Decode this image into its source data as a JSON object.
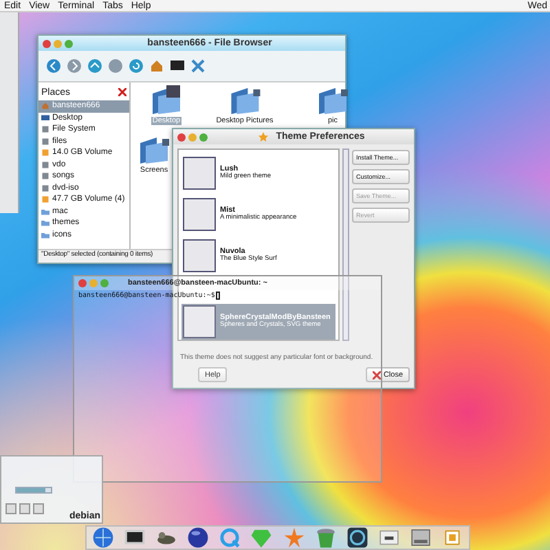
{
  "menu_bar": {
    "items": [
      "Edit",
      "View",
      "Terminal",
      "Tabs",
      "Help"
    ],
    "clock": "Wed"
  },
  "file_browser": {
    "title": "bansteen666 - File Browser",
    "places_label": "Places",
    "places": [
      {
        "label": "bansteen666",
        "kind": "home",
        "selected": true
      },
      {
        "label": "Desktop",
        "kind": "desktop",
        "selected": false
      },
      {
        "label": "File System",
        "kind": "drive",
        "selected": false
      },
      {
        "label": "files",
        "kind": "drive",
        "selected": false
      },
      {
        "label": "14.0 GB Volume",
        "kind": "volume",
        "selected": false
      },
      {
        "label": "vdo",
        "kind": "drive",
        "selected": false
      },
      {
        "label": "songs",
        "kind": "drive",
        "selected": false
      },
      {
        "label": "dvd-iso",
        "kind": "drive",
        "selected": false
      },
      {
        "label": "47.7 GB Volume (4)",
        "kind": "volume",
        "selected": false
      },
      {
        "label": "mac",
        "kind": "bookmark",
        "selected": false
      },
      {
        "label": "themes",
        "kind": "bookmark",
        "selected": false
      },
      {
        "label": "icons",
        "kind": "bookmark",
        "selected": false
      }
    ],
    "files": [
      {
        "label": "Desktop",
        "selected": true
      },
      {
        "label": "Desktop Pictures",
        "selected": false
      },
      {
        "label": "pic",
        "selected": false
      },
      {
        "label": "Screens",
        "selected": false
      }
    ],
    "status": "\"Desktop\" selected (containing 0 items)"
  },
  "theme_window": {
    "title": "Theme Preferences",
    "themes": [
      {
        "name": "Lush",
        "description": "Mild green theme",
        "selected": false
      },
      {
        "name": "Mist",
        "description": "A minimalistic appearance",
        "selected": false
      },
      {
        "name": "Nuvola",
        "description": "The Blue Style Surf",
        "selected": false
      },
      {
        "name": "SphereCrystalModByBansteen",
        "description": "Spheres and Crystals, SVG theme",
        "selected": true
      }
    ],
    "buttons": [
      {
        "label": "Install Theme...",
        "disabled": false
      },
      {
        "label": "Customize...",
        "disabled": false
      },
      {
        "label": "Save Theme...",
        "disabled": true
      },
      {
        "label": "Revert",
        "disabled": true
      }
    ],
    "note": "This theme does not suggest any particular font or background.",
    "help": "Help",
    "close": "Close"
  },
  "terminal": {
    "title": "bansteen666@bansteen-macUbuntu: ~",
    "prompt": "bansteen666@bansteen-macUbuntu:~$"
  },
  "media_player": {
    "label": "debian",
    "level": 0.85
  },
  "dock": {
    "items": [
      {
        "kind": "globe"
      },
      {
        "kind": "monitor"
      },
      {
        "kind": "animal"
      },
      {
        "kind": "sphere"
      },
      {
        "kind": "q"
      },
      {
        "kind": "gem"
      },
      {
        "kind": "star"
      },
      {
        "kind": "bin"
      },
      {
        "kind": "letter"
      },
      {
        "kind": "device"
      },
      {
        "kind": "drive"
      },
      {
        "kind": "square"
      }
    ]
  }
}
